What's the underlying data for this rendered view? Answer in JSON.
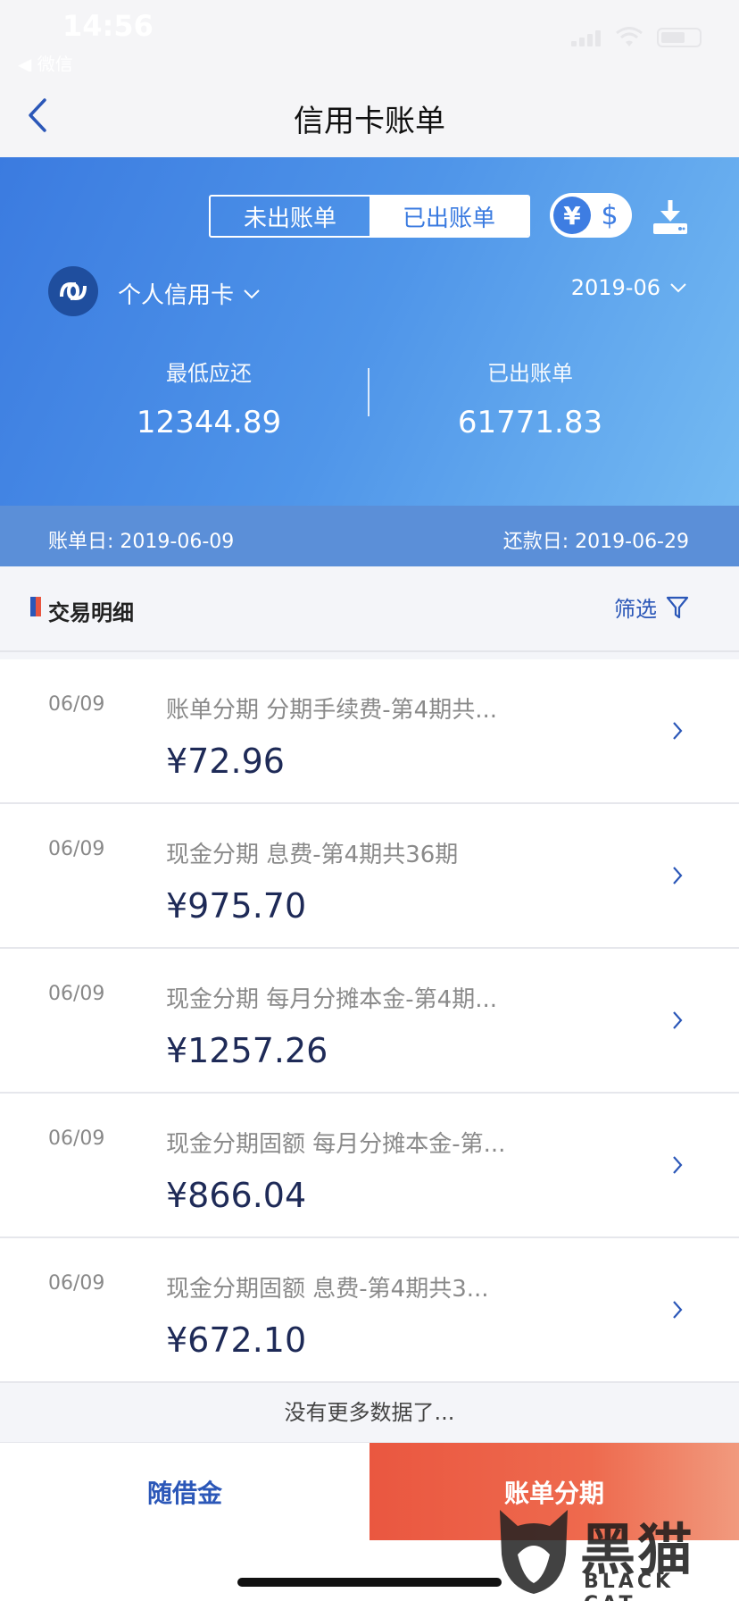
{
  "status": {
    "time": "14:56",
    "back_app": "◀ 微信"
  },
  "nav": {
    "title": "信用卡账单"
  },
  "hero": {
    "tabs": {
      "unbilled": "未出账单",
      "billed": "已出账单"
    },
    "currency": {
      "cny": "¥",
      "usd": "$"
    },
    "card_name": "个人信用卡",
    "month": "2019-06",
    "min_due_label": "最低应还",
    "min_due_value": "12344.89",
    "billed_label": "已出账单",
    "billed_value": "61771.83"
  },
  "dates": {
    "bill_date": "账单日: 2019-06-09",
    "due_date": "还款日: 2019-06-29"
  },
  "section": {
    "title": "交易明细",
    "filter": "筛选"
  },
  "transactions": [
    {
      "date": "06/09",
      "desc": "账单分期 分期手续费-第4期共...",
      "amount": "¥72.96"
    },
    {
      "date": "06/09",
      "desc": "现金分期 息费-第4期共36期",
      "amount": "¥975.70"
    },
    {
      "date": "06/09",
      "desc": "现金分期 每月分摊本金-第4期...",
      "amount": "¥1257.26"
    },
    {
      "date": "06/09",
      "desc": "现金分期固额 每月分摊本金-第...",
      "amount": "¥866.04"
    },
    {
      "date": "06/09",
      "desc": "现金分期固额 息费-第4期共3...",
      "amount": "¥672.10"
    }
  ],
  "no_more": "没有更多数据了...",
  "bottom": {
    "loan": "随借金",
    "installment": "账单分期"
  },
  "watermark": {
    "zh": "黑猫",
    "en": "BLACK CAT"
  },
  "colors": {
    "accent_blue": "#3b7be0",
    "amount_navy": "#1e2a57",
    "cta_red": "#ea5740"
  }
}
